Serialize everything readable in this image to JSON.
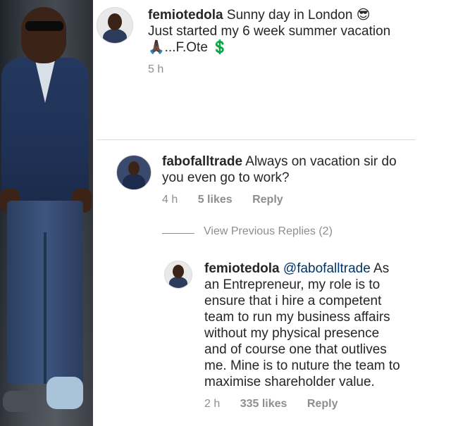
{
  "post": {
    "username": "femiotedola",
    "caption_line1": "Sunny day in London 😎",
    "caption_line2": "Just started my 6 week summer vacation",
    "caption_line3": "🙏🏿...F.Ote 💲",
    "time": "5 h"
  },
  "comment": {
    "username": "fabofalltrade",
    "text_line1": "Always on vacation sir do",
    "text_line2": "you even go to work?",
    "time": "4 h",
    "likes": "5 likes",
    "reply_label": "Reply"
  },
  "view_previous_replies": "View Previous Replies (2)",
  "reply": {
    "username": "femiotedola",
    "mention": "@fabofalltrade",
    "line1_rest": "As",
    "lines": [
      "an Entrepreneur, my role is to",
      "ensure that i hire a competent",
      "team to run my business affairs",
      "without my physical presence",
      "and of course one that outlives",
      "me. Mine is to nuture the team to",
      "maximise shareholder value."
    ],
    "time": "2 h",
    "likes": "335 likes",
    "reply_label": "Reply"
  },
  "colors": {
    "text": "#262626",
    "muted": "#8e8e8e",
    "mention": "#003569",
    "divider": "#dbdbdb"
  }
}
